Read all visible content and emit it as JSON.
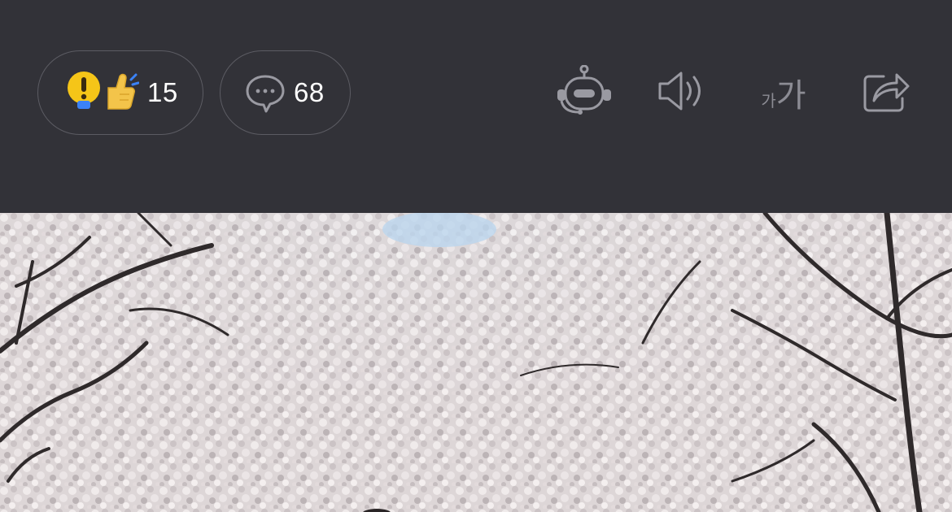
{
  "toolbar": {
    "reaction": {
      "icons": [
        "lightbulb-icon",
        "thumbs-up-icon"
      ],
      "count": "15"
    },
    "comments": {
      "icon": "speech-bubble-icon",
      "count": "68"
    },
    "actions": [
      {
        "name": "ai-assistant",
        "icon": "robot-icon"
      },
      {
        "name": "text-to-speech",
        "icon": "speaker-icon"
      },
      {
        "name": "font-size",
        "label_small": "가",
        "label_large": "가"
      },
      {
        "name": "share",
        "icon": "share-icon"
      }
    ]
  },
  "photo": {
    "subject": "cherry-blossom-trees"
  },
  "colors": {
    "background": "#323238",
    "pill_border": "#5c5c63",
    "icon_gray": "#8c8c94",
    "bulb_yellow": "#f5c518",
    "thumb_yellow": "#f3c44a",
    "accent_blue": "#3b82f6"
  }
}
